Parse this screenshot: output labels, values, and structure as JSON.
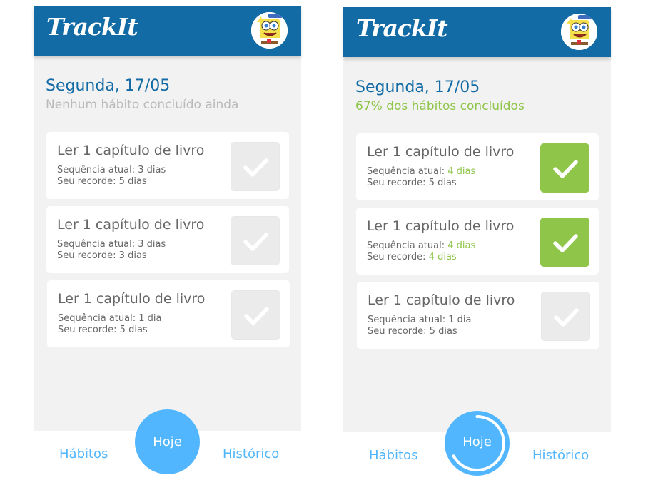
{
  "screens": [
    {
      "app_title": "TrackIt",
      "date": "Segunda, 17/05",
      "summary": "Nenhum hábito concluído ainda",
      "summary_state": "none",
      "habits": [
        {
          "name": "Ler 1 capítulo de livro",
          "streak_label": "Sequência atual:",
          "streak": "3 dias",
          "record_label": "Seu recorde:",
          "record": "5 dias",
          "done": false
        },
        {
          "name": "Ler 1 capítulo de livro",
          "streak_label": "Sequência atual:",
          "streak": "3 dias",
          "record_label": "Seu recorde:",
          "record": "3 dias",
          "done": false
        },
        {
          "name": "Ler 1 capítulo de livro",
          "streak_label": "Sequência atual:",
          "streak": "1 dia",
          "record_label": "Seu recorde:",
          "record": "5 dias",
          "done": false
        }
      ],
      "nav": {
        "habits": "Hábitos",
        "today": "Hoje",
        "history": "Histórico"
      },
      "progress": 0
    },
    {
      "app_title": "TrackIt",
      "date": "Segunda, 17/05",
      "summary": "67% dos hábitos concluídos",
      "summary_state": "partial",
      "habits": [
        {
          "name": "Ler 1 capítulo de livro",
          "streak_label": "Sequência atual:",
          "streak": "4 dias",
          "record_label": "Seu recorde:",
          "record": "5 dias",
          "done": true
        },
        {
          "name": "Ler 1 capítulo de livro",
          "streak_label": "Sequência atual:",
          "streak": "4 dias",
          "record_label": "Seu recorde:",
          "record": "4 dias",
          "done": true
        },
        {
          "name": "Ler 1 capítulo de livro",
          "streak_label": "Sequência atual:",
          "streak": "1 dia",
          "record_label": "Seu recorde:",
          "record": "5 dias",
          "done": false
        }
      ],
      "nav": {
        "habits": "Hábitos",
        "today": "Hoje",
        "history": "Histórico"
      },
      "progress": 0.67
    }
  ],
  "colors": {
    "header": "#126ba5",
    "accent": "#52b6ff",
    "done": "#8fc549",
    "muted": "#bababa",
    "check_off": "#ebebeb"
  },
  "icons": {
    "check": "check-icon",
    "avatar": "user-avatar"
  }
}
